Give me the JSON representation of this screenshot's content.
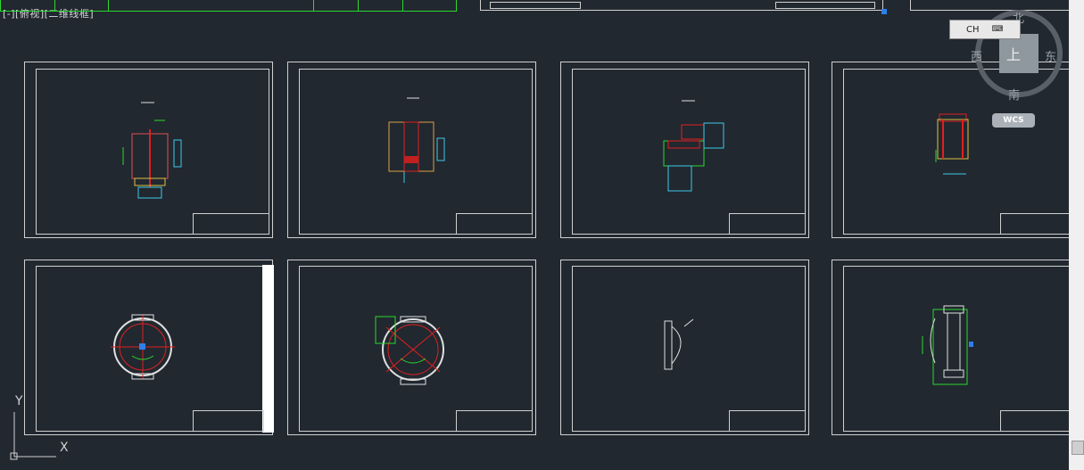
{
  "viewport": {
    "label": "[-][俯视][二维线框]"
  },
  "compass": {
    "north": "北",
    "south": "南",
    "east": "东",
    "west": "西",
    "top": "上"
  },
  "ime": {
    "label": "CH"
  },
  "ucs": {
    "wcs_label": "WCS",
    "x_label": "X",
    "y_label": "Y"
  }
}
